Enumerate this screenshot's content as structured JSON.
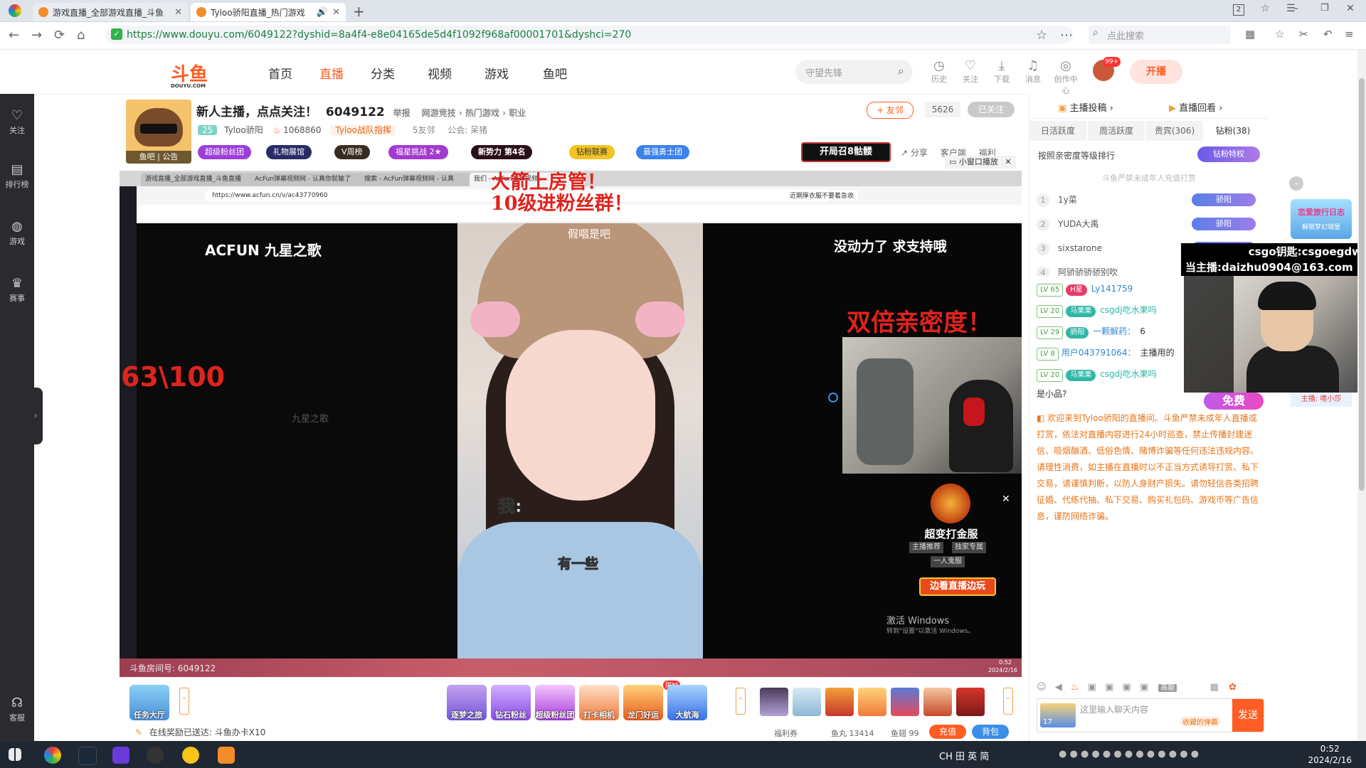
{
  "browser": {
    "tabs": [
      {
        "title": "游戏直播_全部游戏直播_斗鱼"
      },
      {
        "title": "Tyloo骄阳直播_热门游戏"
      }
    ],
    "url": "https://www.douyu.com/6049122?dyshid=8a4f4-e8e04165de5d4f1092f968af00001701&dyshci=270",
    "search_placeholder": "点此搜索",
    "window_badge": "2"
  },
  "site": {
    "logo": "斗鱼",
    "logo_sub": "DOUYU.COM",
    "nav": [
      "首页",
      "直播",
      "分类",
      "视频",
      "游戏",
      "鱼吧"
    ],
    "search_placeholder": "守望先锋",
    "header_icons": [
      "历史",
      "关注",
      "下载",
      "消息",
      "创作中心"
    ],
    "avatar_badge": "99+",
    "kaibo": "开播"
  },
  "leftbar": [
    "关注",
    "排行榜",
    "游戏",
    "赛事",
    "客服"
  ],
  "room": {
    "avatar_caption": "鱼吧 | 公告",
    "title": "新人主播，点点关注！",
    "room_id": "6049122",
    "report": "举报",
    "category": "网游竞技 › 热门游戏 › 职业",
    "level": "25",
    "streamer": "Tyloo骄阳",
    "hot": "1068860",
    "team": "Tyloo战队指挥",
    "friends": "5友邻",
    "guild": "公会: 呆猪",
    "follow": "+ 友邻",
    "follow_count": "5626",
    "followed": "已关注",
    "share": "分享",
    "client": "客户端",
    "welfare": "福利",
    "mini": "小窗口播放",
    "badges": [
      "超级粉丝团",
      "礼物展馆",
      "V周榜",
      "福星挑战 2★",
      "新势力 第4名",
      "钻粉联赛",
      "最强勇士团"
    ],
    "event_banner": "开局召8骷髅"
  },
  "video": {
    "inner_tabs": [
      "游戏直播_全部游戏直播_斗鱼直播",
      "AcFun弹幕视频网 - 认真你就输了",
      "搜索 - AcFun弹幕视频网 - 认真",
      "我们 - AcFun弹幕视频"
    ],
    "inner_url": "https://www.acfun.cn/v/ac43770960",
    "inner_notice": "近期厚衣服不要着急收",
    "overlay_red_1": "大箭上房管！",
    "overlay_red_2": "10级进粉丝群！",
    "overlay_double": "双倍亲密度！",
    "counter": "63\\100",
    "acfun_logo": "ACFUN 九星之歌",
    "acfun_watermark": "九星之歌",
    "right_caption": "没动力了 求支持哦",
    "top_caption": "假唱是吧",
    "sub_wo": "我:",
    "sub_line": "有一些",
    "promo_name": "超变打金服",
    "promo_tags": [
      "主播推荐",
      "独家专属",
      "一人鬼服"
    ],
    "promo_button": "边看直播边玩",
    "win_activate": "激活 Windows",
    "win_activate_sub": "转到\"设置\"以激活 Windows。",
    "room_overlay": "斗鱼房间号: 6049122",
    "inner_date": "2024/2/16",
    "inner_time": "0:52"
  },
  "toolbar": {
    "task": "任务大厅",
    "gifts": [
      "逐梦之旅",
      "钻石粉丝",
      "超级粉丝团",
      "打卡相机",
      "龙门好运",
      "大航海"
    ],
    "limited": "限时",
    "online_reward": "在线奖励已送达: 斗鱼办卡X10",
    "welfare": "福利券",
    "fish_ball": "鱼丸 13414",
    "fish_fin": "鱼翅 99",
    "recharge": "充值",
    "bag": "背包"
  },
  "right": {
    "top_links": [
      "主播投稿",
      "直播回看"
    ],
    "tabs": [
      "日活跃度",
      "周活跃度",
      "贵宾(306)",
      "钻粉(38)"
    ],
    "rank_title": "按照亲密度等级排行",
    "diamond_btn": "钻粉特权",
    "minor_notice": "斗鱼严禁未成年人充值打赏",
    "ranks": [
      {
        "n": "1",
        "name": "1y菜",
        "badge": "骄阳"
      },
      {
        "n": "2",
        "name": "YUDA大禹",
        "badge": "骄阳"
      },
      {
        "n": "3",
        "name": "sixstarone",
        "badge": "骄阳"
      },
      {
        "n": "4",
        "name": "阿骄骄骄骄别吹",
        "badge": ""
      }
    ],
    "chats": [
      {
        "lv": "LV 65",
        "fan": "H星",
        "user": "Ly141759",
        "text": ""
      },
      {
        "lv": "LV 20",
        "fan": "马栗栗",
        "user": "csgdj吃水果吗",
        "text": ""
      },
      {
        "lv": "LV 29",
        "fan": "骄阳",
        "user": "一颗解药：",
        "text": "6"
      },
      {
        "lv": "LV 8",
        "fan": "",
        "user": "用户043791064：",
        "text": "主播用的"
      },
      {
        "lv": "LV 20",
        "fan": "马栗栗",
        "user": "csgdj吃水果吗",
        "text": ""
      }
    ],
    "chat_tail": "是小品?",
    "notice": "欢迎来到Tyloo骄阳的直播间。斗鱼严禁未成年人直播或打赏，依法对直播内容进行24小时巡查，禁止传播封建迷信、吸烟酗酒、低俗色情、赌博诈骗等任何违法违规内容。请理性消费，如主播在直播时以不正当方式诱导打赏、私下交易，请谨慎判断，以防人身财产损失。请勿轻信各类招聘征婚、代练代抽、私下交易、购买礼包码、游戏币等广告信息，谨防网络诈骗。",
    "input_placeholder": "这里输入聊天内容",
    "send": "发送",
    "barrage": "收藏的弹幕",
    "level_tag": "17",
    "high_energy": "高能"
  },
  "overlay": {
    "csgo_line1": "csgo钥匙:csgoegdw",
    "csgo_line2": "当主播:daizhu0904@163.com",
    "free": "免费",
    "host": "主播: 嗜小莎",
    "love": "恋爱旅行日志",
    "love_sub": "解锁梦幻城堡"
  },
  "taskbar": {
    "ime": "CH 田 英 简",
    "time": "0:52",
    "date": "2024/2/16"
  },
  "colors": {
    "accent": "#ff5d23",
    "live": "#ff5d23",
    "notice": "#e8751a",
    "overlay_red": "#e0231d"
  }
}
